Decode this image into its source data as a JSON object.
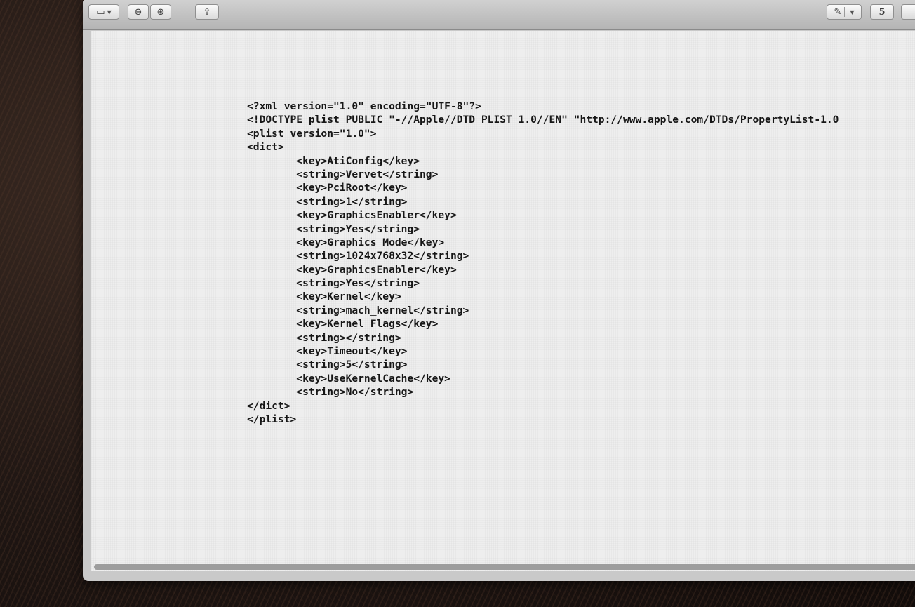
{
  "toolbar": {
    "buttons": [
      {
        "icon": "sidebar-icon",
        "glyph": "▭",
        "has_caret": true
      },
      {
        "icon": "zoom-out-icon",
        "glyph": "⊖",
        "has_caret": false
      },
      {
        "icon": "zoom-in-icon",
        "glyph": "⊕",
        "has_caret": false
      },
      {
        "icon": "share-icon",
        "glyph": "⇪",
        "has_caret": false
      },
      {
        "icon": "annotate-pen-icon",
        "glyph": "✎",
        "has_caret": true
      },
      {
        "icon": "page-number",
        "glyph": "5",
        "has_caret": false
      }
    ]
  },
  "document": {
    "lines": [
      "<?xml version=\"1.0\" encoding=\"UTF-8\"?>",
      "<!DOCTYPE plist PUBLIC \"-//Apple//DTD PLIST 1.0//EN\" \"http://www.apple.com/DTDs/PropertyList-1.0",
      "<plist version=\"1.0\">",
      "<dict>",
      "        <key>AtiConfig</key>",
      "        <string>Vervet</string>",
      "        <key>PciRoot</key>",
      "        <string>1</string>",
      "        <key>GraphicsEnabler</key>",
      "        <string>Yes</string>",
      "        <key>Graphics Mode</key>",
      "        <string>1024x768x32</string>",
      "        <key>GraphicsEnabler</key>",
      "        <string>Yes</string>",
      "        <key>Kernel</key>",
      "        <string>mach_kernel</string>",
      "        <key>Kernel Flags</key>",
      "        <string></string>",
      "        <key>Timeout</key>",
      "        <string>5</string>",
      "        <key>UseKernelCache</key>",
      "        <string>No</string>",
      "</dict>",
      "</plist>"
    ]
  }
}
